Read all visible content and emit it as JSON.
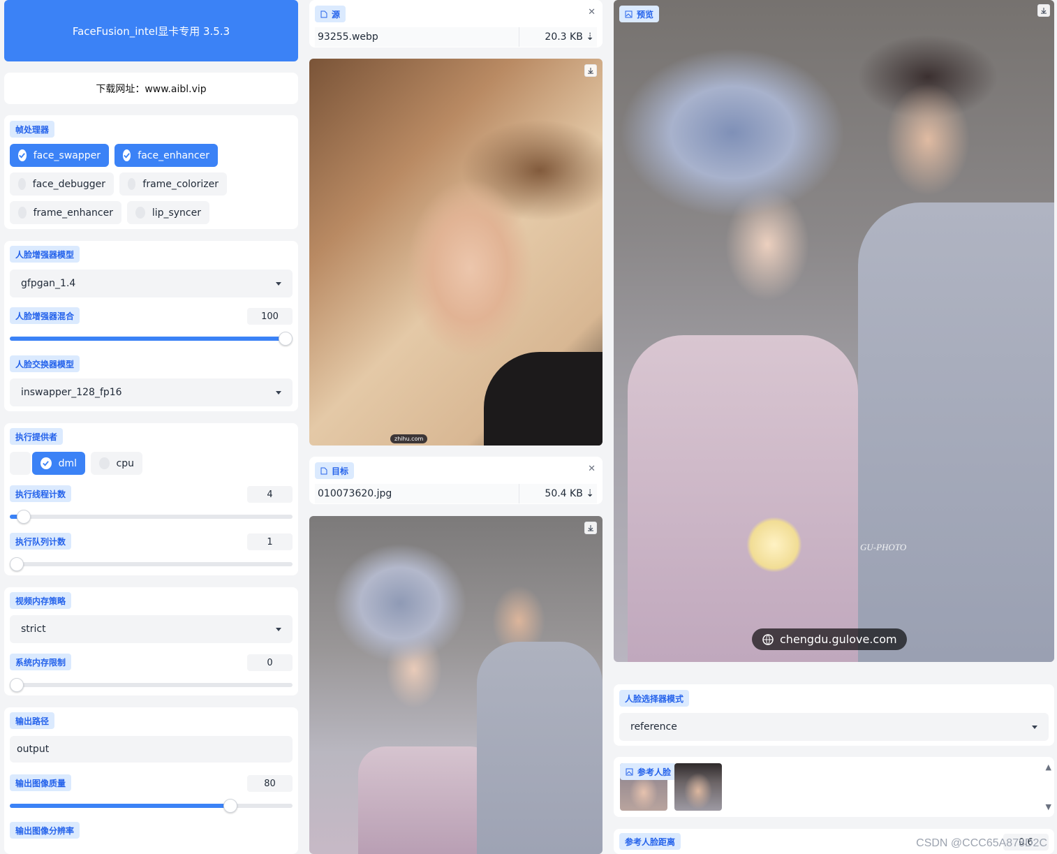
{
  "app": {
    "title": "FaceFusion_intel显卡专用 3.5.3",
    "download_link": "下载网址：www.aibl.vip"
  },
  "processors": {
    "label": "帧处理器",
    "items": [
      {
        "label": "face_swapper",
        "checked": true
      },
      {
        "label": "face_enhancer",
        "checked": true
      },
      {
        "label": "face_debugger",
        "checked": false
      },
      {
        "label": "frame_colorizer",
        "checked": false
      },
      {
        "label": "frame_enhancer",
        "checked": false
      },
      {
        "label": "lip_syncer",
        "checked": false
      }
    ]
  },
  "enhancer": {
    "model_label": "人脸增强器模型",
    "model_value": "gfpgan_1.4",
    "blend_label": "人脸增强器混合",
    "blend_value": "100",
    "blend_level": 100,
    "swapper_label": "人脸交换器模型",
    "swapper_value": "inswapper_128_fp16"
  },
  "execution": {
    "provider_label": "执行提供者",
    "providers": [
      {
        "label": "dml",
        "checked": true
      },
      {
        "label": "cpu",
        "checked": false
      }
    ],
    "threads_label": "执行线程计数",
    "threads_value": "4",
    "queue_label": "执行队列计数",
    "queue_value": "1"
  },
  "memory": {
    "strategy_label": "视频内存策略",
    "strategy_value": "strict",
    "limit_label": "系统内存限制",
    "limit_value": "0"
  },
  "output": {
    "path_label": "输出路径",
    "path_value": "output",
    "quality_label": "输出图像质量",
    "quality_value": "80",
    "resolution_label": "输出图像分辨率"
  },
  "source": {
    "label": "源",
    "filename": "93255.webp",
    "size": "20.3 KB ⇣",
    "image_watermark": "zhihu.com"
  },
  "target": {
    "label": "目标",
    "filename": "010073620.jpg",
    "size": "50.4 KB ⇣"
  },
  "preview": {
    "label": "预览",
    "watermark": "chengdu.gulove.com",
    "photo_mark": "GU-PHOTO"
  },
  "face_selector": {
    "label": "人脸选择器模式",
    "value": "reference"
  },
  "reference_face": {
    "label": "参考人脸"
  },
  "reference_distance": {
    "label": "参考人脸距离",
    "value": "0.6"
  },
  "footer": {
    "watermark": "CSDN @CCC65A878D2C"
  },
  "icons": {
    "check": "check-icon",
    "file": "file-icon",
    "close": "close-icon",
    "download": "download-icon",
    "image": "image-icon",
    "globe": "globe-icon"
  },
  "colors": {
    "accent": "#3b82f6",
    "chip_bg": "#dbeafe",
    "chip_text": "#2563eb"
  }
}
